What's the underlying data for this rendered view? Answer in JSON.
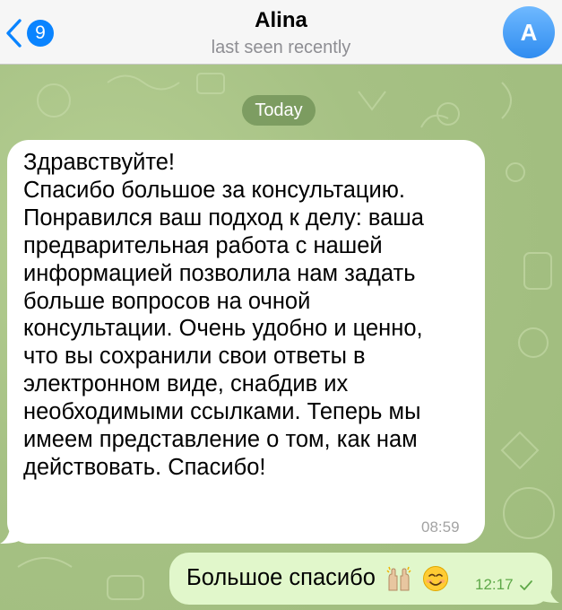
{
  "header": {
    "unread_count": "9",
    "title": "Alina",
    "status": "last seen recently",
    "avatar_letter": "A"
  },
  "date_divider": "Today",
  "messages": [
    {
      "direction": "incoming",
      "lines": [
        "Здравствуйте!",
        "Спасибо большое за консультацию.",
        "Понравился ваш подход к делу: ваша",
        "предварительная работа с нашей",
        "информацией позволила нам задать",
        "больше вопросов на очной",
        "консультации. Очень удобно и ценно,",
        "что вы сохранили свои ответы в",
        "электронном виде, снабдив их",
        "необходимыми ссылками. Теперь мы",
        "имеем представление о том, как нам",
        "действовать. Спасибо!"
      ],
      "time": "08:59"
    },
    {
      "direction": "outgoing",
      "text": "Большое спасибо",
      "emojis": [
        "raising-hands-emoji",
        "smiling-face-emoji"
      ],
      "time": "12:17",
      "read_status": "sent-check"
    }
  ],
  "colors": {
    "accent": "#0a84ff",
    "outgoing_bubble": "#e1f7cb",
    "incoming_bubble": "#ffffff",
    "wallpaper": "#a9c48a",
    "outgoing_time": "#5ea848"
  }
}
